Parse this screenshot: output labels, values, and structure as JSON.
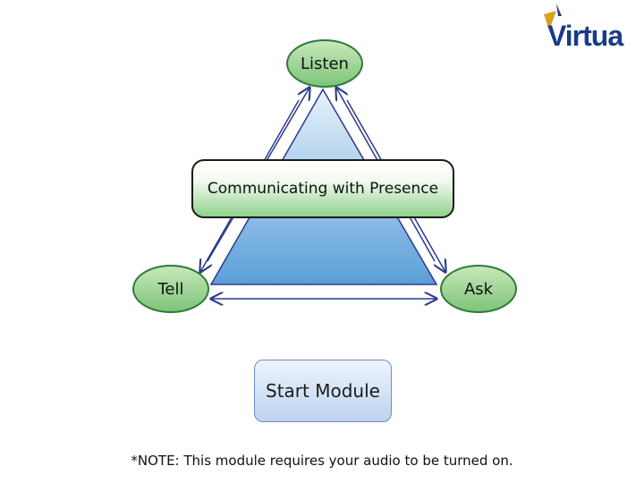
{
  "brand": {
    "name": "Virtua"
  },
  "diagram": {
    "top_node": "Listen",
    "left_node": "Tell",
    "right_node": "Ask",
    "center": "Communicating with Presence"
  },
  "start_button": {
    "label": "Start Module"
  },
  "note": "*NOTE:  This module requires your audio to be turned on.",
  "colors": {
    "node_green": "#7ec47a",
    "triangle_blue": "#5a9fd8",
    "arrow_navy": "#2b3a8c",
    "brand_blue": "#1a3b8a",
    "brand_gold": "#d6a21f"
  }
}
